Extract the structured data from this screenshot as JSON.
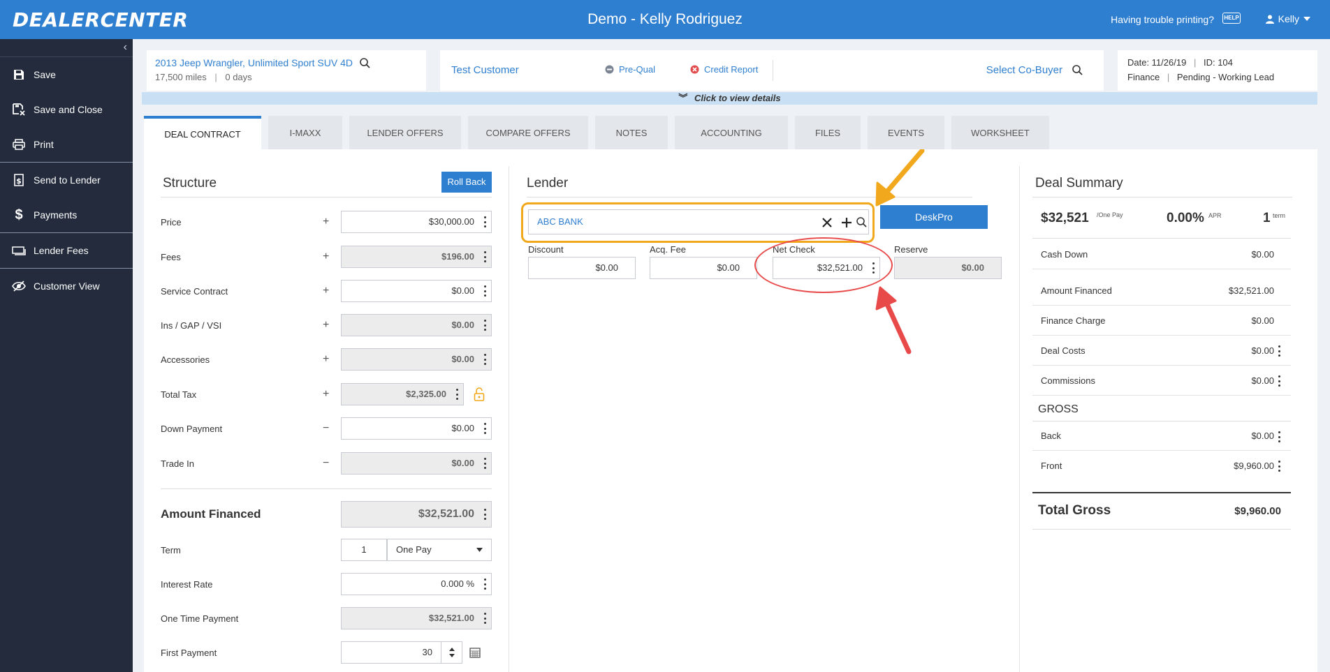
{
  "header": {
    "logo": "DEALERCENTER",
    "title": "Demo - Kelly Rodriguez",
    "trouble_link": "Having trouble printing?",
    "help_label": "HELP",
    "user_name": "Kelly"
  },
  "sidebar": {
    "items": [
      {
        "label": "Save",
        "icon": "save-icon"
      },
      {
        "label": "Save and Close",
        "icon": "save-close-icon"
      },
      {
        "label": "Print",
        "icon": "printer-icon"
      },
      {
        "label": "Send to Lender",
        "icon": "bank-icon"
      },
      {
        "label": "Payments",
        "icon": "dollar-icon"
      },
      {
        "label": "Lender Fees",
        "icon": "money-icon"
      },
      {
        "label": "Customer View",
        "icon": "eye-slash-icon"
      }
    ]
  },
  "vehicle": {
    "name": "2013 Jeep Wrangler, Unlimited Sport SUV 4D",
    "miles": "17,500 miles",
    "days": "0 days"
  },
  "customer": {
    "name": "Test Customer",
    "prequal": "Pre-Qual",
    "credit_report": "Credit Report",
    "co_buyer": "Select Co-Buyer"
  },
  "deal_meta": {
    "date": "Date: 11/26/19",
    "id": "ID: 104",
    "dept": "Finance",
    "status": "Pending - Working Lead"
  },
  "details_bar": "Click to view details",
  "tabs": [
    "DEAL CONTRACT",
    "I-MAXX",
    "LENDER OFFERS",
    "COMPARE OFFERS",
    "NOTES",
    "ACCOUNTING",
    "FILES",
    "EVENTS",
    "WORKSHEET"
  ],
  "structure": {
    "title": "Structure",
    "rollback": "Roll Back",
    "rows": [
      {
        "label": "Price",
        "op": "+",
        "value": "$30,000.00",
        "gray": false
      },
      {
        "label": "Fees",
        "op": "+",
        "value": "$196.00",
        "gray": true
      },
      {
        "label": "Service Contract",
        "op": "+",
        "value": "$0.00",
        "gray": false
      },
      {
        "label": "Ins / GAP / VSI",
        "op": "+",
        "value": "$0.00",
        "gray": true
      },
      {
        "label": "Accessories",
        "op": "+",
        "value": "$0.00",
        "gray": true
      },
      {
        "label": "Total Tax",
        "op": "+",
        "value": "$2,325.00",
        "gray": true
      },
      {
        "label": "Down Payment",
        "op": "−",
        "value": "$0.00",
        "gray": false
      },
      {
        "label": "Trade In",
        "op": "−",
        "value": "$0.00",
        "gray": true
      }
    ],
    "amount_financed_label": "Amount Financed",
    "amount_financed": "$32,521.00",
    "term_label": "Term",
    "term_value": "1",
    "term_type": "One Pay",
    "interest_label": "Interest Rate",
    "interest_value": "0.000 %",
    "one_time_label": "One Time Payment",
    "one_time_value": "$32,521.00",
    "first_payment_label": "First Payment",
    "first_payment_value": "30"
  },
  "lender": {
    "title": "Lender",
    "bank": "ABC BANK",
    "deskpro": "DeskPro",
    "fields": [
      {
        "label": "Discount",
        "value": "$0.00"
      },
      {
        "label": "Acq. Fee",
        "value": "$0.00"
      },
      {
        "label": "Net Check",
        "value": "$32,521.00"
      },
      {
        "label": "Reserve",
        "value": "$0.00"
      }
    ]
  },
  "summary": {
    "title": "Deal Summary",
    "payment": "$32,521",
    "payment_sub": "/One Pay",
    "apr": "0.00%",
    "apr_sub": "APR",
    "term": "1",
    "term_sub": "term",
    "rows": [
      {
        "label": "Cash Down",
        "value": "$0.00"
      },
      {
        "label": "Amount Financed",
        "value": "$32,521.00"
      },
      {
        "label": "Finance Charge",
        "value": "$0.00"
      },
      {
        "label": "Deal Costs",
        "value": "$0.00"
      },
      {
        "label": "Commissions",
        "value": "$0.00"
      }
    ],
    "gross_title": "GROSS",
    "gross_rows": [
      {
        "label": "Back",
        "value": "$0.00"
      },
      {
        "label": "Front",
        "value": "$9,960.00"
      }
    ],
    "total_label": "Total Gross",
    "total_value": "$9,960.00"
  },
  "annotation_colors": {
    "highlight": "#f2a81d",
    "circle": "#e84a4a"
  }
}
